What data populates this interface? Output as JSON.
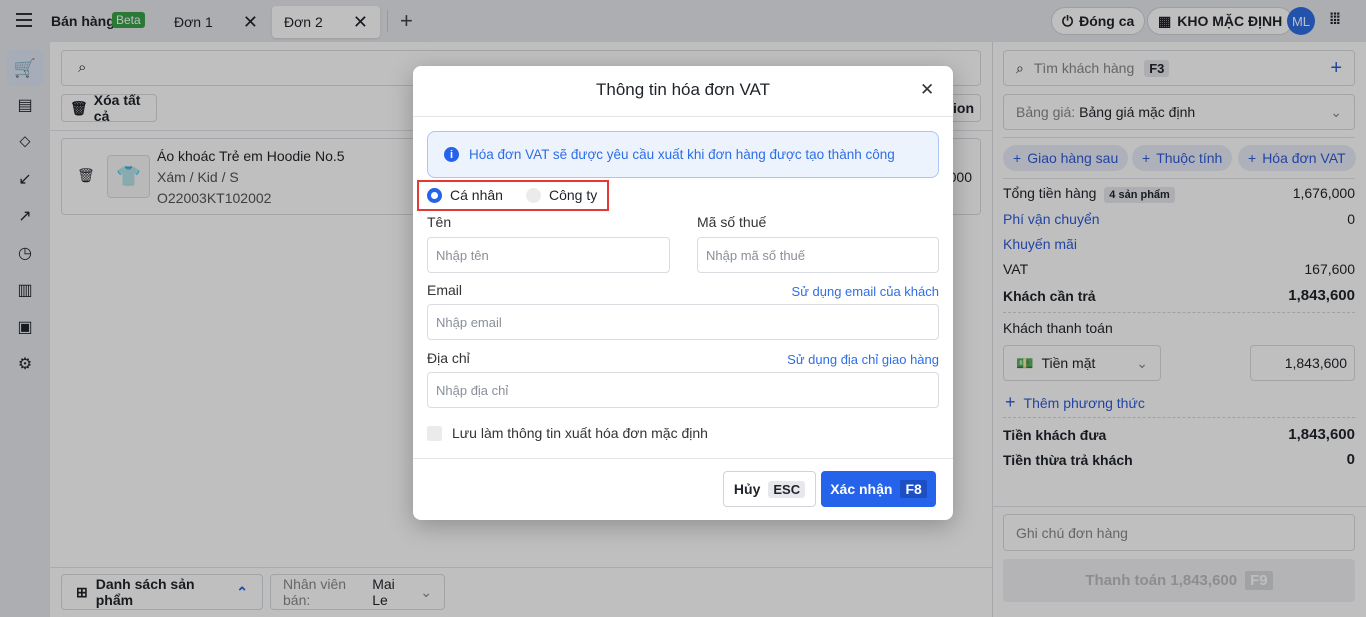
{
  "topbar": {
    "app_title": "Bán hàng",
    "beta_badge": "Beta",
    "tabs": [
      {
        "label": "Đơn 1"
      },
      {
        "label": "Đơn 2"
      }
    ],
    "close_shift": "Đóng ca",
    "warehouse": "KHO MẶC ĐỊNH",
    "avatar_initials": "ML"
  },
  "main": {
    "delete_all": "Xóa tất cả",
    "truncated_action": "tion",
    "product": {
      "name": "Áo khoác Trẻ em Hoodie No.5",
      "variant": "Xám / Kid / S",
      "sku": "O22003KT102002",
      "price_fragment": "000"
    },
    "product_list_btn": "Danh sách sản phẩm",
    "staff_label": "Nhân viên bán:",
    "staff_value": "Mai Le"
  },
  "right": {
    "customer_search_placeholder": "Tìm khách hàng",
    "customer_search_key": "F3",
    "price_list_label": "Bảng giá:",
    "price_list_value": "Bảng giá mặc định",
    "chips": [
      "Giao hàng sau",
      "Thuộc tính",
      "Hóa đơn VAT"
    ],
    "subtotal_label": "Tổng tiền hàng",
    "subtotal_badge": "4 sản phẩm",
    "subtotal": "1,676,000",
    "shipping_label": "Phí vận chuyển",
    "shipping": "0",
    "promo_label": "Khuyến mãi",
    "vat_label": "VAT",
    "vat": "167,600",
    "due_label": "Khách cần trả",
    "due": "1,843,600",
    "pay_label": "Khách thanh toán",
    "pay_method": "Tiền mặt",
    "pay_amount": "1,843,600",
    "add_method": "Thêm phương thức",
    "given_label": "Tiền khách đưa",
    "given": "1,843,600",
    "change_label": "Tiền thừa trả khách",
    "change": "0",
    "note_placeholder": "Ghi chú đơn hàng",
    "checkout_label": "Thanh toán 1,843,600",
    "checkout_key": "F9"
  },
  "modal": {
    "title": "Thông tin hóa đơn VAT",
    "info": "Hóa đơn VAT sẽ được yêu cầu xuất khi đơn hàng được tạo thành công",
    "radio_individual": "Cá nhân",
    "radio_company": "Công ty",
    "name_label": "Tên",
    "name_placeholder": "Nhập tên",
    "tax_label": "Mã số thuế",
    "tax_placeholder": "Nhập mã số thuế",
    "email_label": "Email",
    "email_link": "Sử dụng email của khách",
    "email_placeholder": "Nhập email",
    "address_label": "Địa chỉ",
    "address_link": "Sử dụng địa chỉ giao hàng",
    "address_placeholder": "Nhập địa chỉ",
    "save_default": "Lưu làm thông tin xuất hóa đơn mặc định",
    "cancel": "Hủy",
    "cancel_key": "ESC",
    "confirm": "Xác nhận",
    "confirm_key": "F8"
  },
  "colors": {
    "primary": "#2563eb",
    "highlight": "#e53935",
    "beta": "#3aa14a"
  }
}
